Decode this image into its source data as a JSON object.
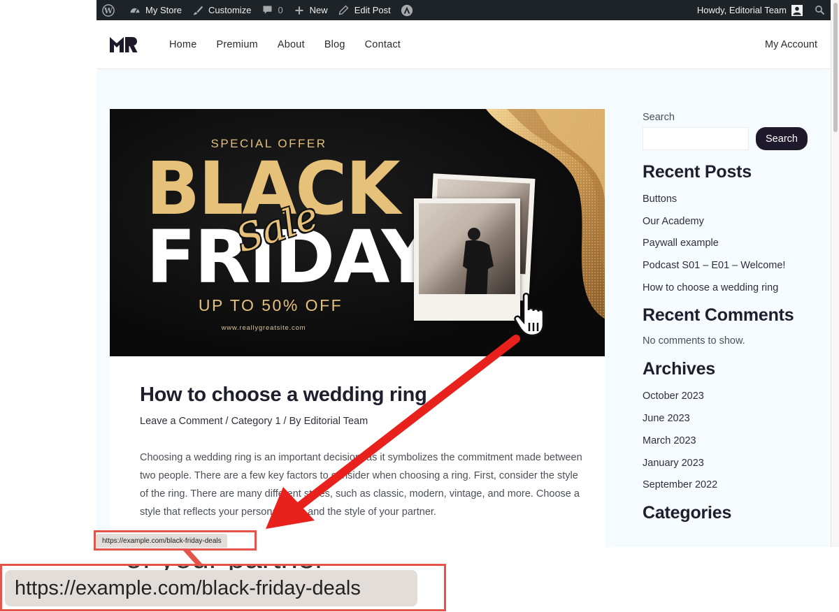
{
  "admin_bar": {
    "items": [
      {
        "icon": "wordpress-logo-icon",
        "label": ""
      },
      {
        "icon": "dashboard-gauge-icon",
        "label": "My Store"
      },
      {
        "icon": "paintbrush-icon",
        "label": "Customize"
      },
      {
        "icon": "comment-bubble-icon",
        "label": "0"
      },
      {
        "icon": "plus-icon",
        "label": "New"
      },
      {
        "icon": "pencil-icon",
        "label": "Edit Post"
      },
      {
        "icon": "astra-logo-icon",
        "label": ""
      }
    ],
    "greeting": "Howdy, Editorial Team",
    "user_icon": "user-avatar-icon",
    "search_icon": "search-icon"
  },
  "header": {
    "logo_text": "MR",
    "nav": [
      "Home",
      "Premium",
      "About",
      "Blog",
      "Contact"
    ],
    "account": "My Account"
  },
  "banner": {
    "special_offer": "SPECIAL OFFER",
    "line1": "BLACK",
    "script": "Sale",
    "line2": "FRIDAY",
    "discount": "UP TO 50% OFF",
    "website": "www.reallygreatsite.com",
    "colors": {
      "gold": "#e6c17a",
      "background": "#0a0a0a"
    }
  },
  "post": {
    "title": "How to choose a wedding ring",
    "meta": {
      "comment_link": "Leave a Comment",
      "category": "Category 1",
      "author_prefix": "By",
      "author": "Editorial Team",
      "separator": " / "
    },
    "body": "Choosing a wedding ring is an important decision, as it symbolizes the commitment made between two people. There are a few key factors to consider when choosing a ring. First, consider the style of the ring. There are many different styles, such as classic, modern, vintage, and more. Choose a style that reflects your personal taste and the style of your partner."
  },
  "sidebar": {
    "search_label": "Search",
    "search_placeholder": "",
    "search_button": "Search",
    "recent_posts": {
      "heading": "Recent Posts",
      "items": [
        "Buttons",
        "Our Academy",
        "Paywall example",
        "Podcast S01 – E01 – Welcome!",
        "How to choose a wedding ring"
      ]
    },
    "recent_comments": {
      "heading": "Recent Comments",
      "empty": "No comments to show."
    },
    "archives": {
      "heading": "Archives",
      "items": [
        "October 2023",
        "June 2023",
        "March 2023",
        "January 2023",
        "September 2022"
      ]
    },
    "categories": {
      "heading": "Categories"
    }
  },
  "status_bar": {
    "url": "https://example.com/black-friday-deals"
  },
  "annotation": {
    "magnified_url": "https://example.com/black-friday-deals",
    "ghost_text": "of your partner",
    "highlight_color": "#e4544a",
    "arrow_color": "#e8211c"
  }
}
